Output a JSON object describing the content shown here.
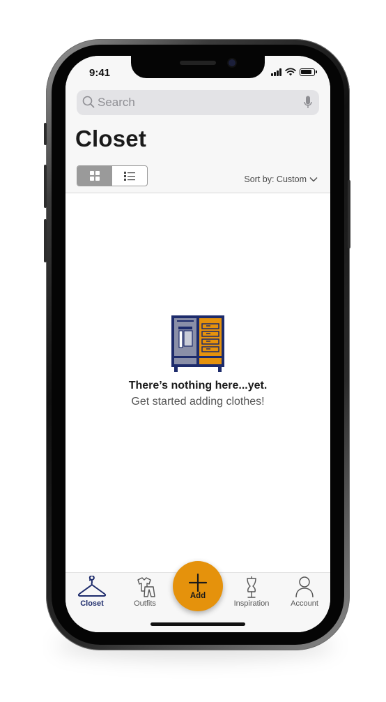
{
  "status_bar": {
    "time": "9:41"
  },
  "search": {
    "placeholder": "Search"
  },
  "page": {
    "title": "Closet"
  },
  "sort": {
    "label": "Sort by: Custom"
  },
  "view_toggle": {
    "active": "grid"
  },
  "empty_state": {
    "title": "There’s nothing here...yet.",
    "subtitle": "Get started adding clothes!"
  },
  "tabs": [
    {
      "label": "Closet",
      "icon": "hanger-icon",
      "active": true
    },
    {
      "label": "Outfits",
      "icon": "outfits-icon",
      "active": false
    },
    {
      "label": "Add",
      "icon": "plus-icon",
      "active": false
    },
    {
      "label": "Inspiration",
      "icon": "mannequin-icon",
      "active": false
    },
    {
      "label": "Account",
      "icon": "person-icon",
      "active": false
    }
  ],
  "colors": {
    "accent": "#e5920c",
    "navy": "#1d2b6b",
    "header_bg": "#f7f7f7"
  }
}
